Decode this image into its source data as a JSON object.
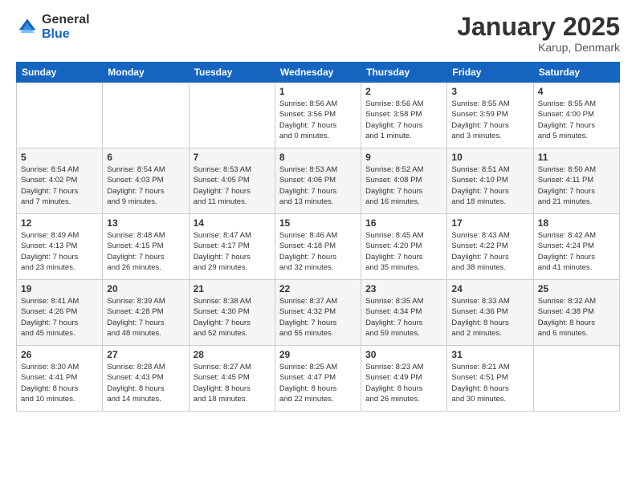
{
  "header": {
    "logo_general": "General",
    "logo_blue": "Blue",
    "title": "January 2025",
    "subtitle": "Karup, Denmark"
  },
  "columns": [
    "Sunday",
    "Monday",
    "Tuesday",
    "Wednesday",
    "Thursday",
    "Friday",
    "Saturday"
  ],
  "rows": [
    [
      {
        "day": "",
        "info": ""
      },
      {
        "day": "",
        "info": ""
      },
      {
        "day": "",
        "info": ""
      },
      {
        "day": "1",
        "info": "Sunrise: 8:56 AM\nSunset: 3:56 PM\nDaylight: 7 hours\nand 0 minutes."
      },
      {
        "day": "2",
        "info": "Sunrise: 8:56 AM\nSunset: 3:58 PM\nDaylight: 7 hours\nand 1 minute."
      },
      {
        "day": "3",
        "info": "Sunrise: 8:55 AM\nSunset: 3:59 PM\nDaylight: 7 hours\nand 3 minutes."
      },
      {
        "day": "4",
        "info": "Sunrise: 8:55 AM\nSunset: 4:00 PM\nDaylight: 7 hours\nand 5 minutes."
      }
    ],
    [
      {
        "day": "5",
        "info": "Sunrise: 8:54 AM\nSunset: 4:02 PM\nDaylight: 7 hours\nand 7 minutes."
      },
      {
        "day": "6",
        "info": "Sunrise: 8:54 AM\nSunset: 4:03 PM\nDaylight: 7 hours\nand 9 minutes."
      },
      {
        "day": "7",
        "info": "Sunrise: 8:53 AM\nSunset: 4:05 PM\nDaylight: 7 hours\nand 11 minutes."
      },
      {
        "day": "8",
        "info": "Sunrise: 8:53 AM\nSunset: 4:06 PM\nDaylight: 7 hours\nand 13 minutes."
      },
      {
        "day": "9",
        "info": "Sunrise: 8:52 AM\nSunset: 4:08 PM\nDaylight: 7 hours\nand 16 minutes."
      },
      {
        "day": "10",
        "info": "Sunrise: 8:51 AM\nSunset: 4:10 PM\nDaylight: 7 hours\nand 18 minutes."
      },
      {
        "day": "11",
        "info": "Sunrise: 8:50 AM\nSunset: 4:11 PM\nDaylight: 7 hours\nand 21 minutes."
      }
    ],
    [
      {
        "day": "12",
        "info": "Sunrise: 8:49 AM\nSunset: 4:13 PM\nDaylight: 7 hours\nand 23 minutes."
      },
      {
        "day": "13",
        "info": "Sunrise: 8:48 AM\nSunset: 4:15 PM\nDaylight: 7 hours\nand 26 minutes."
      },
      {
        "day": "14",
        "info": "Sunrise: 8:47 AM\nSunset: 4:17 PM\nDaylight: 7 hours\nand 29 minutes."
      },
      {
        "day": "15",
        "info": "Sunrise: 8:46 AM\nSunset: 4:18 PM\nDaylight: 7 hours\nand 32 minutes."
      },
      {
        "day": "16",
        "info": "Sunrise: 8:45 AM\nSunset: 4:20 PM\nDaylight: 7 hours\nand 35 minutes."
      },
      {
        "day": "17",
        "info": "Sunrise: 8:43 AM\nSunset: 4:22 PM\nDaylight: 7 hours\nand 38 minutes."
      },
      {
        "day": "18",
        "info": "Sunrise: 8:42 AM\nSunset: 4:24 PM\nDaylight: 7 hours\nand 41 minutes."
      }
    ],
    [
      {
        "day": "19",
        "info": "Sunrise: 8:41 AM\nSunset: 4:26 PM\nDaylight: 7 hours\nand 45 minutes."
      },
      {
        "day": "20",
        "info": "Sunrise: 8:39 AM\nSunset: 4:28 PM\nDaylight: 7 hours\nand 48 minutes."
      },
      {
        "day": "21",
        "info": "Sunrise: 8:38 AM\nSunset: 4:30 PM\nDaylight: 7 hours\nand 52 minutes."
      },
      {
        "day": "22",
        "info": "Sunrise: 8:37 AM\nSunset: 4:32 PM\nDaylight: 7 hours\nand 55 minutes."
      },
      {
        "day": "23",
        "info": "Sunrise: 8:35 AM\nSunset: 4:34 PM\nDaylight: 7 hours\nand 59 minutes."
      },
      {
        "day": "24",
        "info": "Sunrise: 8:33 AM\nSunset: 4:36 PM\nDaylight: 8 hours\nand 2 minutes."
      },
      {
        "day": "25",
        "info": "Sunrise: 8:32 AM\nSunset: 4:38 PM\nDaylight: 8 hours\nand 6 minutes."
      }
    ],
    [
      {
        "day": "26",
        "info": "Sunrise: 8:30 AM\nSunset: 4:41 PM\nDaylight: 8 hours\nand 10 minutes."
      },
      {
        "day": "27",
        "info": "Sunrise: 8:28 AM\nSunset: 4:43 PM\nDaylight: 8 hours\nand 14 minutes."
      },
      {
        "day": "28",
        "info": "Sunrise: 8:27 AM\nSunset: 4:45 PM\nDaylight: 8 hours\nand 18 minutes."
      },
      {
        "day": "29",
        "info": "Sunrise: 8:25 AM\nSunset: 4:47 PM\nDaylight: 8 hours\nand 22 minutes."
      },
      {
        "day": "30",
        "info": "Sunrise: 8:23 AM\nSunset: 4:49 PM\nDaylight: 8 hours\nand 26 minutes."
      },
      {
        "day": "31",
        "info": "Sunrise: 8:21 AM\nSunset: 4:51 PM\nDaylight: 8 hours\nand 30 minutes."
      },
      {
        "day": "",
        "info": ""
      }
    ]
  ]
}
